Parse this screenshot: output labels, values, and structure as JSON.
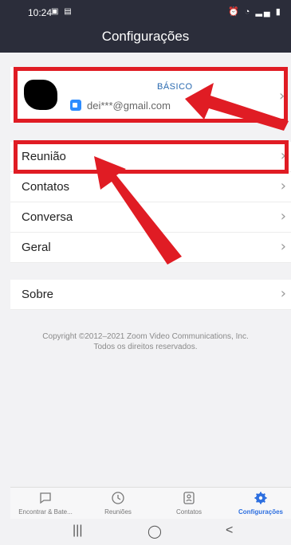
{
  "statusbar": {
    "time": "10:24",
    "left_icons": "▣ ▤",
    "right_icons": "⏰ ◔ ▂▄ ▮"
  },
  "header": {
    "title": "Configurações"
  },
  "profile": {
    "plan": "BÁSICO",
    "email": "dei***@gmail.com"
  },
  "settings_items": [
    {
      "label": "Reunião"
    },
    {
      "label": "Contatos"
    },
    {
      "label": "Conversa"
    },
    {
      "label": "Geral"
    },
    {
      "label": "Sobre"
    }
  ],
  "copyright": {
    "line1": "Copyright ©2012–2021 Zoom Video Communications, Inc.",
    "line2": "Todos os direitos reservados."
  },
  "bottom_nav": {
    "tabs": [
      {
        "label": "Encontrar & Bate...",
        "icon": "chat-bubble-icon"
      },
      {
        "label": "Reuniões",
        "icon": "clock-icon"
      },
      {
        "label": "Contatos",
        "icon": "contact-card-icon"
      },
      {
        "label": "Configurações",
        "icon": "gear-icon",
        "active": true
      }
    ]
  },
  "system_nav": {
    "recents": "|||",
    "home": "◯",
    "back": "<"
  },
  "colors": {
    "header_bg": "#2b2d3a",
    "accent": "#2d6fe0",
    "annotation_red": "#e01c24",
    "background": "#f2f2f4"
  }
}
